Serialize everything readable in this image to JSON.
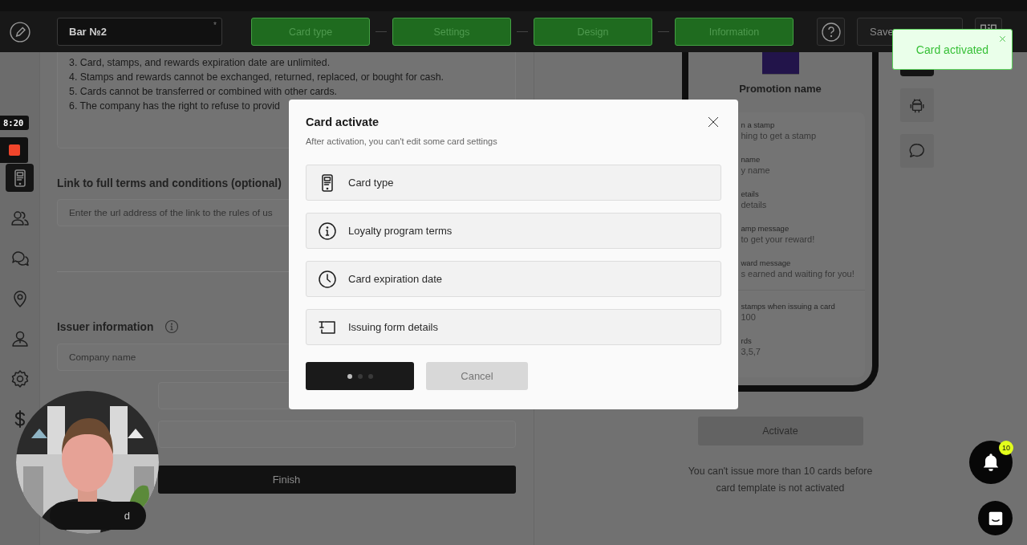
{
  "header": {
    "title_field": {
      "value": "Bar №2",
      "required_mark": "*"
    },
    "steps": [
      {
        "label": "Card type",
        "completed": true
      },
      {
        "label": "Settings",
        "completed": true
      },
      {
        "label": "Design",
        "completed": true
      },
      {
        "label": "Information",
        "completed": true
      }
    ],
    "save_button": "Save"
  },
  "recorder": {
    "time": "8:20"
  },
  "sidebar": {
    "items": [
      {
        "kind": "card",
        "selected": true
      },
      {
        "kind": "users",
        "selected": false
      },
      {
        "kind": "chat",
        "selected": false
      },
      {
        "kind": "pin",
        "selected": false
      },
      {
        "kind": "person",
        "selected": false
      },
      {
        "kind": "gear",
        "selected": false
      },
      {
        "kind": "dollar",
        "selected": false
      }
    ]
  },
  "terms": {
    "lines": [
      "3. Card, stamps, and rewards expiration date are unlimited.",
      "4. Stamps and rewards cannot be exchanged, returned, replaced, or bought for cash.",
      "5. Cards cannot be transferred or combined with other cards.",
      "6. The company has the right to refuse to provid"
    ]
  },
  "terms_link": {
    "label": "Link to full terms and conditions (optional)",
    "placeholder": "Enter the url address of the link to the rules of us"
  },
  "issuer": {
    "label": "Issuer information",
    "fields": [
      {
        "kind": "text",
        "placeholder": "Company name"
      },
      {
        "kind": "text"
      },
      {
        "kind": "text"
      }
    ]
  },
  "finish_button": "Finish",
  "button_2": "d",
  "preview": {
    "promotion_name": "Promotion name",
    "fields": [
      {
        "label": "n a stamp",
        "value": "hing to get a stamp"
      },
      {
        "label": "name",
        "value": "y name"
      },
      {
        "label": "etails",
        "value": "details"
      },
      {
        "label": "amp message",
        "value": "to get your reward!"
      },
      {
        "label": "ward message",
        "value": "s earned and waiting for you!"
      }
    ],
    "stamp_fields": [
      {
        "label": "stamps when issuing a card",
        "value": "100"
      },
      {
        "label": "rds",
        "value": "3,5,7"
      }
    ],
    "platforms": [
      {
        "kind": "dark",
        "selected": true
      },
      {
        "kind": "android",
        "selected": false
      },
      {
        "kind": "message",
        "selected": false
      }
    ]
  },
  "activate_button": {
    "label": "Activate",
    "disabled": true
  },
  "activate_note": "You can't issue more than 10 cards before card template is not activated",
  "notifications": {
    "count": "10"
  },
  "toast": {
    "message": "Card activated"
  },
  "modal": {
    "title": "Card activate",
    "subtitle": "After activation, you can't edit some card settings",
    "items": [
      {
        "kind": "phone",
        "label": "Card type"
      },
      {
        "kind": "info",
        "label": "Loyalty program terms"
      },
      {
        "kind": "clock",
        "label": "Card expiration date"
      },
      {
        "kind": "form",
        "label": "Issuing form details"
      }
    ],
    "confirm_button": {
      "loading": true
    },
    "cancel_button": {
      "label": "Cancel",
      "disabled": true
    }
  }
}
